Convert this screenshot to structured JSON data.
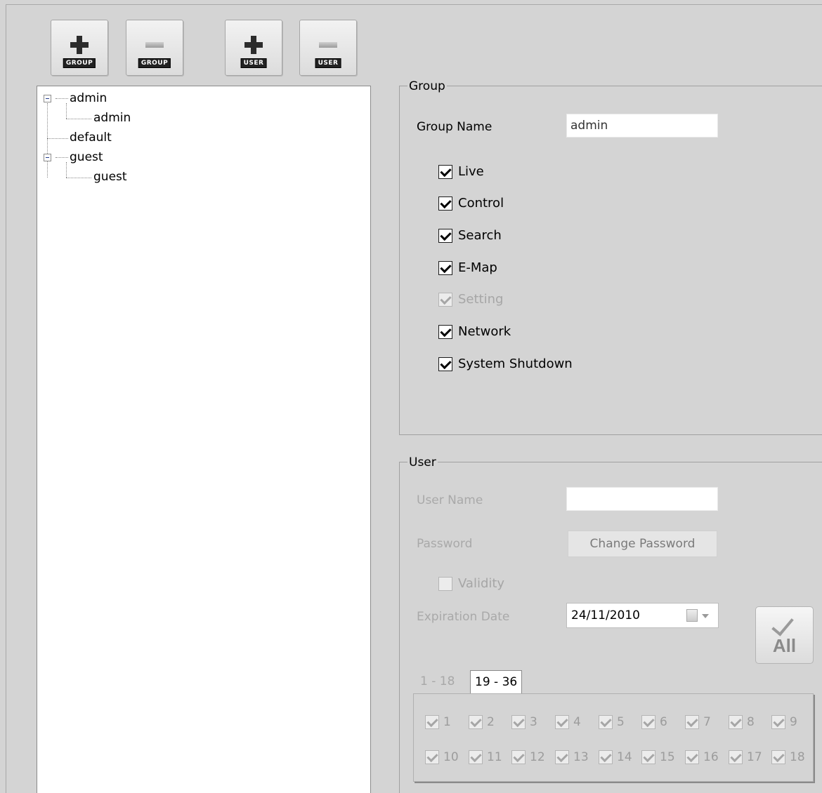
{
  "toolbar": {
    "add_group_tag": "GROUP",
    "remove_group_tag": "GROUP",
    "add_user_tag": "USER",
    "remove_user_tag": "USER"
  },
  "tree": {
    "group_admin": "admin",
    "user_admin": "admin",
    "group_default": "default",
    "group_guest": "guest",
    "user_guest": "guest"
  },
  "group_panel": {
    "title": "Group",
    "name_label": "Group Name",
    "name_value": "admin",
    "permissions": [
      {
        "label": "Live",
        "checked": true,
        "enabled": true
      },
      {
        "label": "Control",
        "checked": true,
        "enabled": true
      },
      {
        "label": "Search",
        "checked": true,
        "enabled": true
      },
      {
        "label": "E-Map",
        "checked": true,
        "enabled": true
      },
      {
        "label": "Setting",
        "checked": true,
        "enabled": false
      },
      {
        "label": "Network",
        "checked": true,
        "enabled": true
      },
      {
        "label": "System Shutdown",
        "checked": true,
        "enabled": true
      }
    ]
  },
  "user_panel": {
    "title": "User",
    "user_name_label": "User Name",
    "user_name_value": "",
    "password_label": "Password",
    "change_password_label": "Change Password",
    "validity_label": "Validity",
    "expiration_label": "Expiration Date",
    "expiration_value": "24/11/2010",
    "all_label": "All",
    "tabs": [
      "1 - 18",
      "19 - 36"
    ],
    "channels": [
      "1",
      "2",
      "3",
      "4",
      "5",
      "6",
      "7",
      "8",
      "9",
      "10",
      "11",
      "12",
      "13",
      "14",
      "15",
      "16",
      "17",
      "18"
    ]
  }
}
